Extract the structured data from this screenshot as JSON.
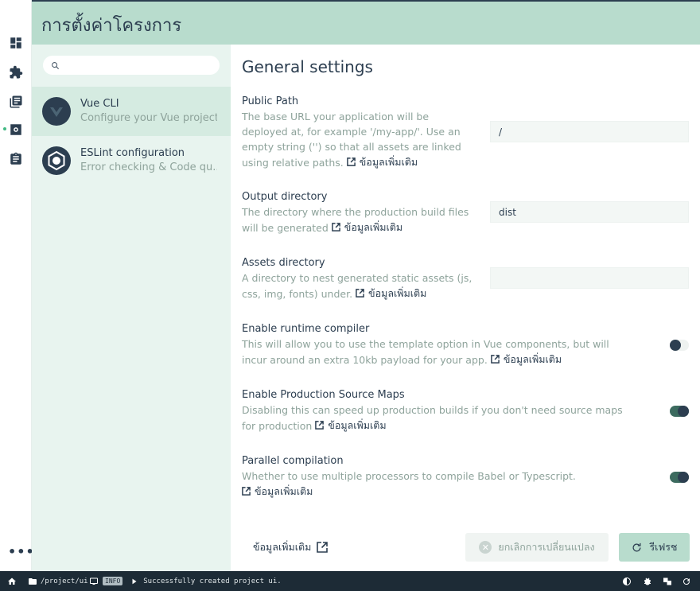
{
  "header": {
    "title": "การตั้งค่าโครงการ"
  },
  "rail": {
    "icons": [
      "dashboard-icon",
      "plugins-icon",
      "dependencies-icon",
      "configuration-icon",
      "tasks-icon"
    ],
    "more_label": "•••"
  },
  "sidebar": {
    "search": {
      "value": "",
      "placeholder": ""
    },
    "items": [
      {
        "name": "Vue CLI",
        "description": "Configure your Vue project",
        "selected": true
      },
      {
        "name": "ESLint configuration",
        "description": "Error checking & Code qu...",
        "selected": false
      }
    ]
  },
  "main": {
    "title": "General settings",
    "more_info_label": "ข้อมูลเพิ่มเติม",
    "settings": [
      {
        "label": "Public Path",
        "description": "The base URL your application will be deployed at, for example '/my-app/'. Use an empty string ('') so that all assets are linked using relative paths.",
        "type": "text",
        "value": "/"
      },
      {
        "label": "Output directory",
        "description": "The directory where the production build files will be generated",
        "type": "text",
        "value": "dist"
      },
      {
        "label": "Assets directory",
        "description": "A directory to nest generated static assets (js, css, img, fonts) under.",
        "type": "text",
        "value": ""
      },
      {
        "label": "Enable runtime compiler",
        "description": "This will allow you to use the template option in Vue components, but will incur around an extra 10kb payload for your app.",
        "type": "toggle",
        "value": false
      },
      {
        "label": "Enable Production Source Maps",
        "description": "Disabling this can speed up production builds if you don't need source maps for production",
        "type": "toggle",
        "value": true
      },
      {
        "label": "Parallel compilation",
        "description": "Whether to use multiple processors to compile Babel or Typescript.",
        "type": "toggle",
        "value": true
      }
    ],
    "footer": {
      "more_info_label": "ข้อมูลเพิ่มเติม",
      "cancel_label": "ยกเลิกการเปลี่ยนแปลง",
      "refresh_label": "รีเฟรช"
    }
  },
  "statusbar": {
    "path": "/project/ui",
    "log_level": "INFO",
    "message": "Successfully created project ui."
  },
  "colors": {
    "header": "#b8dccd",
    "sidebar": "#e8f4ef",
    "text": "#2c3e50",
    "muted": "#8ea39b",
    "statusbar": "#1d2b36"
  }
}
